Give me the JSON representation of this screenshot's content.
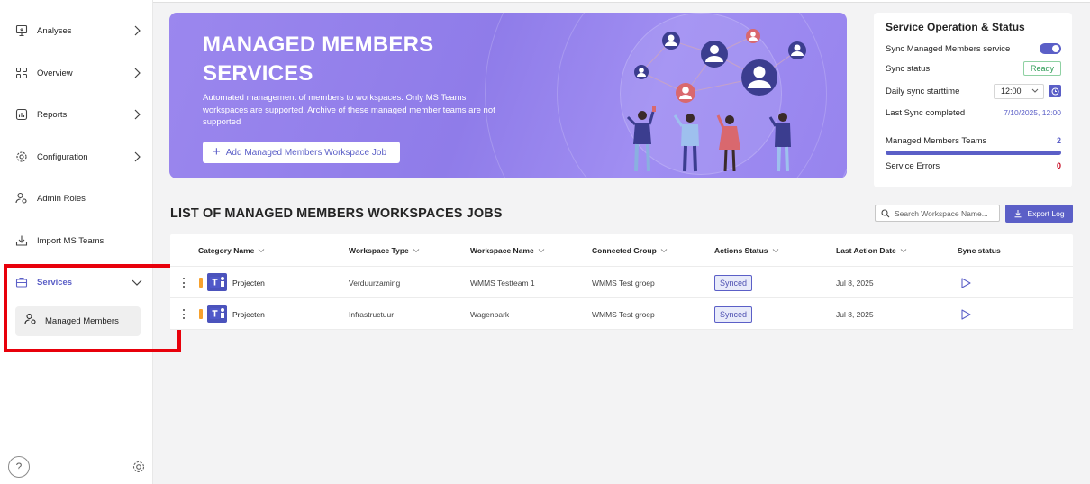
{
  "sidebar": {
    "items": [
      {
        "label": "Analyses",
        "icon": "monitor-icon",
        "chevron": "right"
      },
      {
        "label": "Overview",
        "icon": "grid-icon",
        "chevron": "right"
      },
      {
        "label": "Reports",
        "icon": "chart-icon",
        "chevron": "right"
      },
      {
        "label": "Configuration",
        "icon": "gear-icon",
        "chevron": "right"
      },
      {
        "label": "Admin Roles",
        "icon": "person-settings-icon",
        "chevron": ""
      },
      {
        "label": "Import MS Teams",
        "icon": "import-icon",
        "chevron": ""
      },
      {
        "label": "Services",
        "icon": "briefcase-icon",
        "chevron": "down",
        "active": true
      }
    ],
    "sub_items": [
      {
        "label": "Managed Members",
        "icon": "person-settings-icon"
      }
    ],
    "help_label": "?"
  },
  "banner": {
    "title_line1": "MANAGED MEMBERS",
    "title_line2": "SERVICES",
    "description": "Automated management of members to workspaces. Only MS Teams workspaces are supported. Archive of these managed member teams are not supported",
    "button_label": "Add Managed Members Workspace Job"
  },
  "status_card": {
    "title": "Service Operation & Status",
    "sync_service_label": "Sync Managed Members service",
    "sync_service_enabled": true,
    "sync_status_label": "Sync status",
    "sync_status_value": "Ready",
    "daily_sync_label": "Daily sync starttime",
    "daily_sync_value": "12:00",
    "last_sync_label": "Last Sync completed",
    "last_sync_value": "7/10/2025, 12:00",
    "teams_label": "Managed Members Teams",
    "teams_value": "2",
    "teams_progress": 1.0,
    "errors_label": "Service Errors",
    "errors_value": "0"
  },
  "section": {
    "title": "LIST OF MANAGED MEMBERS WORKSPACES JOBS",
    "search_placeholder": "Search Workspace Name...",
    "export_label": "Export Log"
  },
  "table": {
    "columns": [
      "Category Name",
      "Workspace Type",
      "Workspace Name",
      "Connected Group",
      "Actions Status",
      "Last Action Date",
      "Sync status"
    ],
    "rows": [
      {
        "category": "Projecten",
        "type": "Verduurzaming",
        "workspace": "WMMS Testteam 1",
        "group": "WMMS Test groep",
        "status": "Synced",
        "date": "Jul 8, 2025"
      },
      {
        "category": "Projecten",
        "type": "Infrastructuur",
        "workspace": "Wagenpark",
        "group": "WMMS Test groep",
        "status": "Synced",
        "date": "Jul 8, 2025"
      }
    ]
  },
  "colors": {
    "accent": "#5b5fc7",
    "banner": "#9b87ee",
    "highlight": "#e8000b",
    "orange": "#f7a12d",
    "ready": "#2e9b55",
    "error": "#c4001a"
  }
}
